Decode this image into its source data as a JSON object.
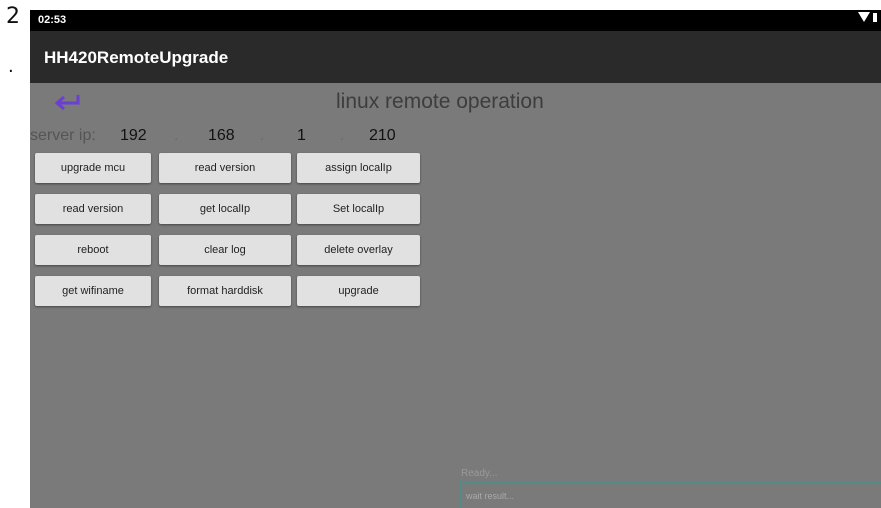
{
  "margin": {
    "number": "2",
    "mark": "."
  },
  "status_bar": {
    "time": "02:53"
  },
  "app": {
    "title": "HH420RemoteUpgrade"
  },
  "header": {
    "title": "linux remote operation"
  },
  "server": {
    "label": "server ip:",
    "octets": [
      "192",
      "168",
      "1",
      "210"
    ],
    "separator": "."
  },
  "buttons": [
    "upgrade mcu",
    "read version",
    "assign localIp",
    "read version",
    "get localIp",
    "Set localIp",
    "reboot",
    "clear log",
    "delete overlay",
    "get wifiname",
    "format harddisk",
    "upgrade"
  ],
  "status": {
    "text": "Ready...",
    "result_placeholder": "wait result..."
  },
  "icons": [
    "back-arrow-icon",
    "wifi-icon",
    "battery-icon"
  ],
  "colors": {
    "accent": "#6b3fd1",
    "background": "#7a7a7a",
    "app_bar": "#2a2a2a",
    "button": "#e1e1e1",
    "result_border": "#4f8d86"
  }
}
